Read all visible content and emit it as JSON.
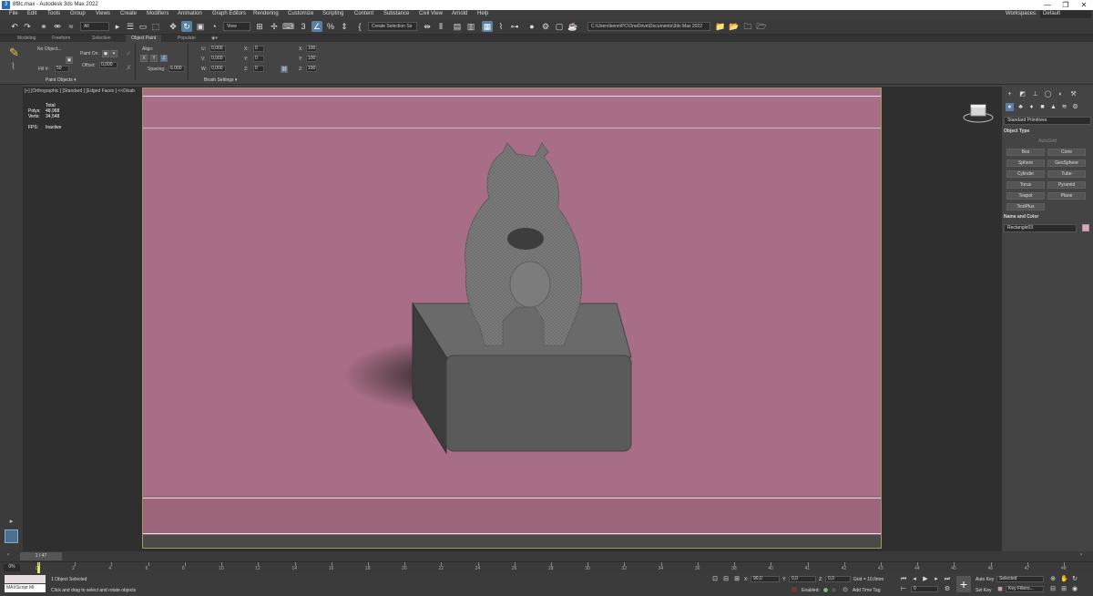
{
  "window": {
    "title": "8f8c.max - Autodesk 3ds Max 2022",
    "icon_text": "3",
    "controls": [
      "—",
      "❐",
      "✕"
    ]
  },
  "menubar": {
    "items": [
      "File",
      "Edit",
      "Tools",
      "Group",
      "Views",
      "Create",
      "Modifiers",
      "Animation",
      "Graph Editors",
      "Rendering",
      "Customize",
      "Scripting",
      "Content",
      "Substance",
      "Civil View",
      "Arnold",
      "Help"
    ],
    "workspaces_label": "Workspaces:",
    "workspaces_value": "Default"
  },
  "toolbar": {
    "filter_value": "All",
    "ref_coord_value": "View",
    "selection_set_value": "Create Selection Se",
    "project_path": "C:\\Users\\kenn\\PC\\OneDrive\\Documents\\3ds Max 2022"
  },
  "ribbon": {
    "tabs": [
      "Modeling",
      "Freeform",
      "Selection",
      "Object Paint",
      "Populate"
    ],
    "active_tab": "Object Paint",
    "no_object": "No Object...",
    "paint_on_label": "Paint On:",
    "fill_label": "Fill #:",
    "fill_value": "50",
    "offset_label": "Offset:",
    "offset_value": "0,000",
    "align_label": "Align:",
    "axis_x": "X",
    "axis_y": "Y",
    "axis_z": "Z",
    "spacing_label": "Spacing:",
    "spacing_value": "6.000",
    "u_label": "U:",
    "u_value": "0,000",
    "v_label": "V:",
    "v_value": "0,000",
    "w_label": "W:",
    "w_value": "0,000",
    "x_label": "X:",
    "x_value": "0",
    "y_label": "Y:",
    "y_value": "0",
    "z_label": "Z:",
    "z_value": "0",
    "xp_label": "X:",
    "xp_value": "100",
    "yp_label": "Y:",
    "yp_value": "100",
    "zp_label": "Z:",
    "zp_value": "100",
    "section_paint_objects": "Paint Objects ▾",
    "section_brush_settings": "Brush Settings ▾"
  },
  "viewport": {
    "label": "[+] [Orthographic ] [Standard ] [Edged Faces ]  <<Disab",
    "stats_total": "Total",
    "polys_label": "Polys:",
    "polys_value": "48,968",
    "verts_label": "Verts:",
    "verts_value": "34,548",
    "fps_label": "FPS:",
    "fps_value": "Inactive",
    "bg_color": "#a86d87"
  },
  "command_panel": {
    "dropdown_value": "Standard Primitives",
    "object_type_header": "Object Type",
    "autogrid_label": "AutoGrid",
    "buttons": [
      "Box",
      "Cone",
      "Sphere",
      "GeoSphere",
      "Cylinder",
      "Tube",
      "Torus",
      "Pyramid",
      "Teapot",
      "Plane",
      "TextPlus"
    ],
    "name_color_header": "Name and Color",
    "name_value": "Rectangle03",
    "swatch_color": "#e8a0c0"
  },
  "timeline": {
    "frame_label": "1 / 47",
    "ticks": [
      "0",
      "2",
      "4",
      "6",
      "8",
      "10",
      "12",
      "14",
      "16",
      "18",
      "20",
      "22",
      "24",
      "26",
      "28",
      "30",
      "32",
      "34",
      "36",
      "38",
      "40",
      "41",
      "42",
      "43",
      "44",
      "45",
      "46",
      "47",
      "48"
    ]
  },
  "status": {
    "maxscript_label": "MAXScript Mi:",
    "objects_selected": "1 Object Selected",
    "prompt": "Click and drag to select and rotate objects",
    "x_label": "X:",
    "x_value": "90,0",
    "y_label": "Y:",
    "y_value": "0,0",
    "z_label": "Z:",
    "z_value": "0,0",
    "grid_label": "Grid = 10,0mm",
    "enabled_label": "Enabled:",
    "add_time_tag": "Add Time Tag",
    "autokey_label": "Auto Key",
    "setkey_label": "Set Key",
    "selected_value": "Selected",
    "key_filters": "Key Filters...",
    "frame_value": "0",
    "timeslider_percent": "0%"
  }
}
